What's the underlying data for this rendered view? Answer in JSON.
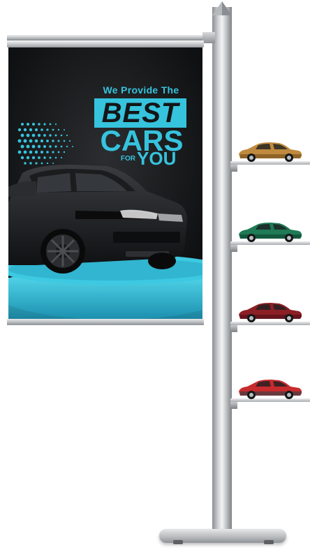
{
  "poster": {
    "headline_small": "We Provide The",
    "headline_best": "BEST",
    "headline_cars": "CARS",
    "headline_for": "FOR",
    "headline_you": "YOU"
  },
  "colors": {
    "accent": "#36c3dd",
    "poster_bg": "#141516",
    "pole": "#c8cacd"
  },
  "model_cars": [
    {
      "color": "#c08a3e",
      "shade": "#7b5420"
    },
    {
      "color": "#1f7a55",
      "shade": "#0f4a33"
    },
    {
      "color": "#8c1f25",
      "shade": "#55101a"
    },
    {
      "color": "#c82b2e",
      "shade": "#3e3f44"
    }
  ]
}
